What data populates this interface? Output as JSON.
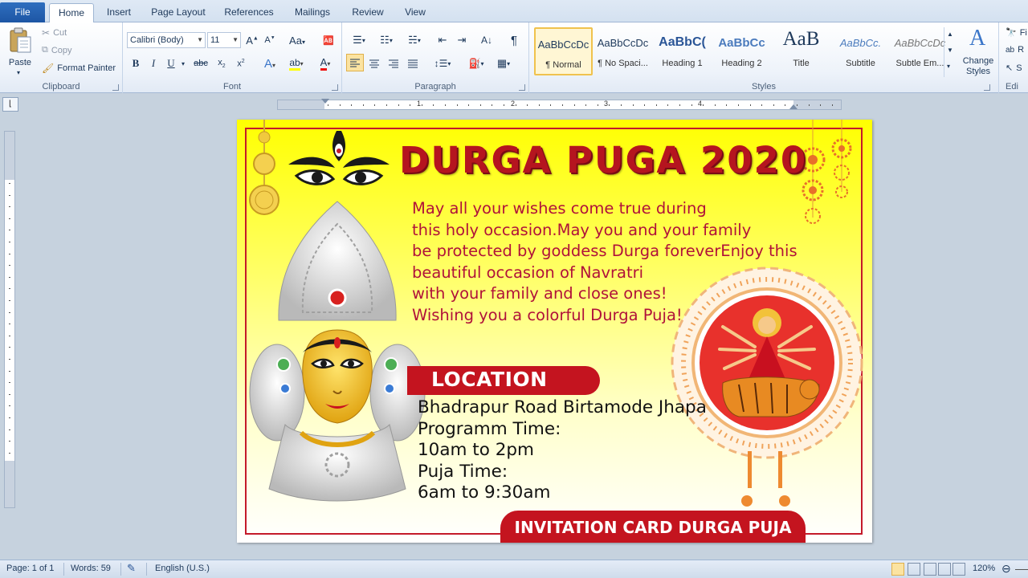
{
  "tabs": [
    "File",
    "Home",
    "Insert",
    "Page Layout",
    "References",
    "Mailings",
    "Review",
    "View"
  ],
  "active_tab": "Home",
  "clipboard": {
    "paste": "Paste",
    "cut": "Cut",
    "copy": "Copy",
    "format_painter": "Format Painter",
    "label": "Clipboard"
  },
  "font": {
    "name": "Calibri (Body)",
    "size": "11",
    "bold": "B",
    "italic": "I",
    "underline": "U",
    "strike": "abc",
    "label": "Font"
  },
  "paragraph": {
    "label": "Paragraph",
    "pilcrow": "¶"
  },
  "styles": {
    "label": "Styles",
    "items": [
      {
        "sample": "AaBbCcDc",
        "name": "¶ Normal"
      },
      {
        "sample": "AaBbCcDc",
        "name": "¶ No Spaci..."
      },
      {
        "sample": "AaBbC(",
        "name": "Heading 1"
      },
      {
        "sample": "AaBbCc",
        "name": "Heading 2"
      },
      {
        "sample": "AaB",
        "name": "Title"
      },
      {
        "sample": "AaBbCc.",
        "name": "Subtitle"
      },
      {
        "sample": "AaBbCcDc",
        "name": "Subtle Em..."
      }
    ],
    "change_styles": "Change Styles"
  },
  "editing": {
    "find": "Fi",
    "replace": "R",
    "select": "S",
    "label": "Edi"
  },
  "ruler": {
    "numbers": [
      "1",
      "2",
      "3",
      "4"
    ]
  },
  "document": {
    "title": "DURGA PUGA 2020",
    "message_lines": [
      "May all your wishes come true during",
      "this holy occasion.May you and your family",
      "be protected by goddess Durga foreverEnjoy this",
      "beautiful occasion of Navratri",
      "with your family and close ones!",
      "Wishing you a colorful Durga Puja!"
    ],
    "location_heading": "LOCATION",
    "details": [
      "Bhadrapur Road Birtamode Jhapa",
      "Programm Time:",
      "10am to 2pm",
      "Puja Time:",
      "6am to 9:30am"
    ],
    "footer": "INVITATION CARD DURGA PUJA"
  },
  "status": {
    "page": "Page: 1 of 1",
    "words": "Words: 59",
    "language": "English (U.S.)",
    "zoom": "120%"
  },
  "colors": {
    "title_red": "#b5151f",
    "message_text": "#b0113a",
    "band_red": "#c4141f",
    "page_top": "#ffff00"
  }
}
